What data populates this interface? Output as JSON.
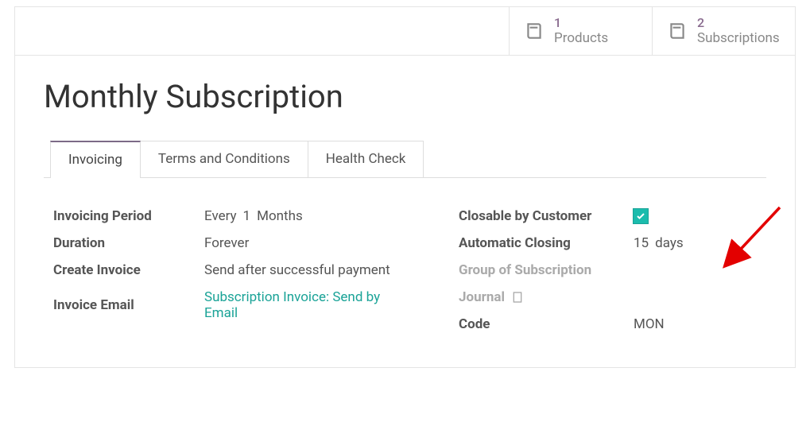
{
  "stats": {
    "products": {
      "count": "1",
      "label": "Products"
    },
    "subscriptions": {
      "count": "2",
      "label": "Subscriptions"
    }
  },
  "title": "Monthly Subscription",
  "tabs": {
    "invoicing": "Invoicing",
    "terms": "Terms and Conditions",
    "health": "Health Check"
  },
  "fields": {
    "invoicing_period": {
      "label": "Invoicing Period",
      "prefix": "Every",
      "value": "1",
      "unit": "Months"
    },
    "duration": {
      "label": "Duration",
      "value": "Forever"
    },
    "create_invoice": {
      "label": "Create Invoice",
      "value": "Send after successful payment"
    },
    "invoice_email": {
      "label": "Invoice Email",
      "value": "Subscription Invoice: Send by Email"
    },
    "closable": {
      "label": "Closable by Customer"
    },
    "auto_closing": {
      "label": "Automatic Closing",
      "value": "15",
      "unit": "days"
    },
    "group": {
      "label": "Group of Subscription"
    },
    "journal": {
      "label": "Journal"
    },
    "code": {
      "label": "Code",
      "value": "MON"
    }
  }
}
